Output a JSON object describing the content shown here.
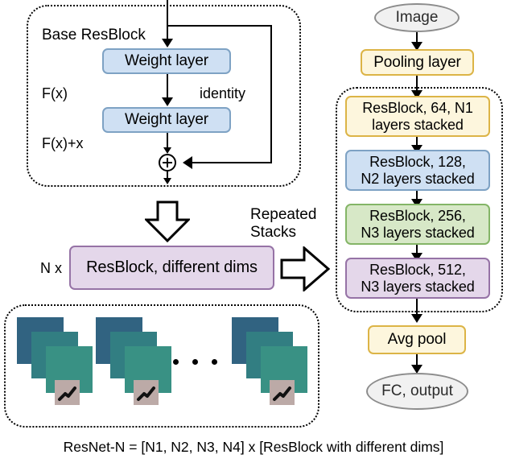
{
  "figure": {
    "caption": "ResNet-N = [N1, N2, N3, N4] x [ResBlock with different dims]"
  },
  "base_resblock_panel": {
    "title": "Base ResBlock",
    "fx_label": "F(x)",
    "fx_plus_x_label": "F(x)+x",
    "identity_label": "identity",
    "weight_layer_1": "Weight layer",
    "weight_layer_2": "Weight layer",
    "sum_operator": "plus"
  },
  "repeat_section": {
    "n_times_label": "N x",
    "resblock_generic": "ResBlock, different dims",
    "repeated_stacks_label": "Repeated\nStacks",
    "down_arrow_name": "down-block-arrow",
    "right_arrow_name": "right-block-arrow"
  },
  "pipeline": {
    "input": "Image",
    "pooling": "Pooling layer",
    "stages": [
      {
        "text": "ResBlock, 64, N1\nlayers stacked",
        "color": "yellow"
      },
      {
        "text": "ResBlock, 128,\nN2 layers stacked",
        "color": "blue"
      },
      {
        "text": "ResBlock, 256,\nN3 layers stacked",
        "color": "green"
      },
      {
        "text": "ResBlock, 512,\nN3 layers stacked",
        "color": "purple"
      }
    ],
    "avg_pool": "Avg pool",
    "output": "FC, output"
  },
  "image_samples": {
    "count_shown": 3,
    "ellipsis": "•••"
  },
  "colors": {
    "blue_fill": "#cfe0f3",
    "blue_stroke": "#7ea2c4",
    "yellow_fill": "#fdf6dd",
    "yellow_stroke": "#dcb446",
    "green_fill": "#d7e8c7",
    "green_stroke": "#84b567",
    "purple_fill": "#e4d7ea",
    "purple_stroke": "#9673a6",
    "ellipse_fill": "#f1f1f1",
    "ellipse_stroke": "#8c8c8c",
    "card_dark_blue": "#316381",
    "card_teal": "#327e82",
    "card_green": "#399184",
    "card_note": "#bcaaa7"
  }
}
